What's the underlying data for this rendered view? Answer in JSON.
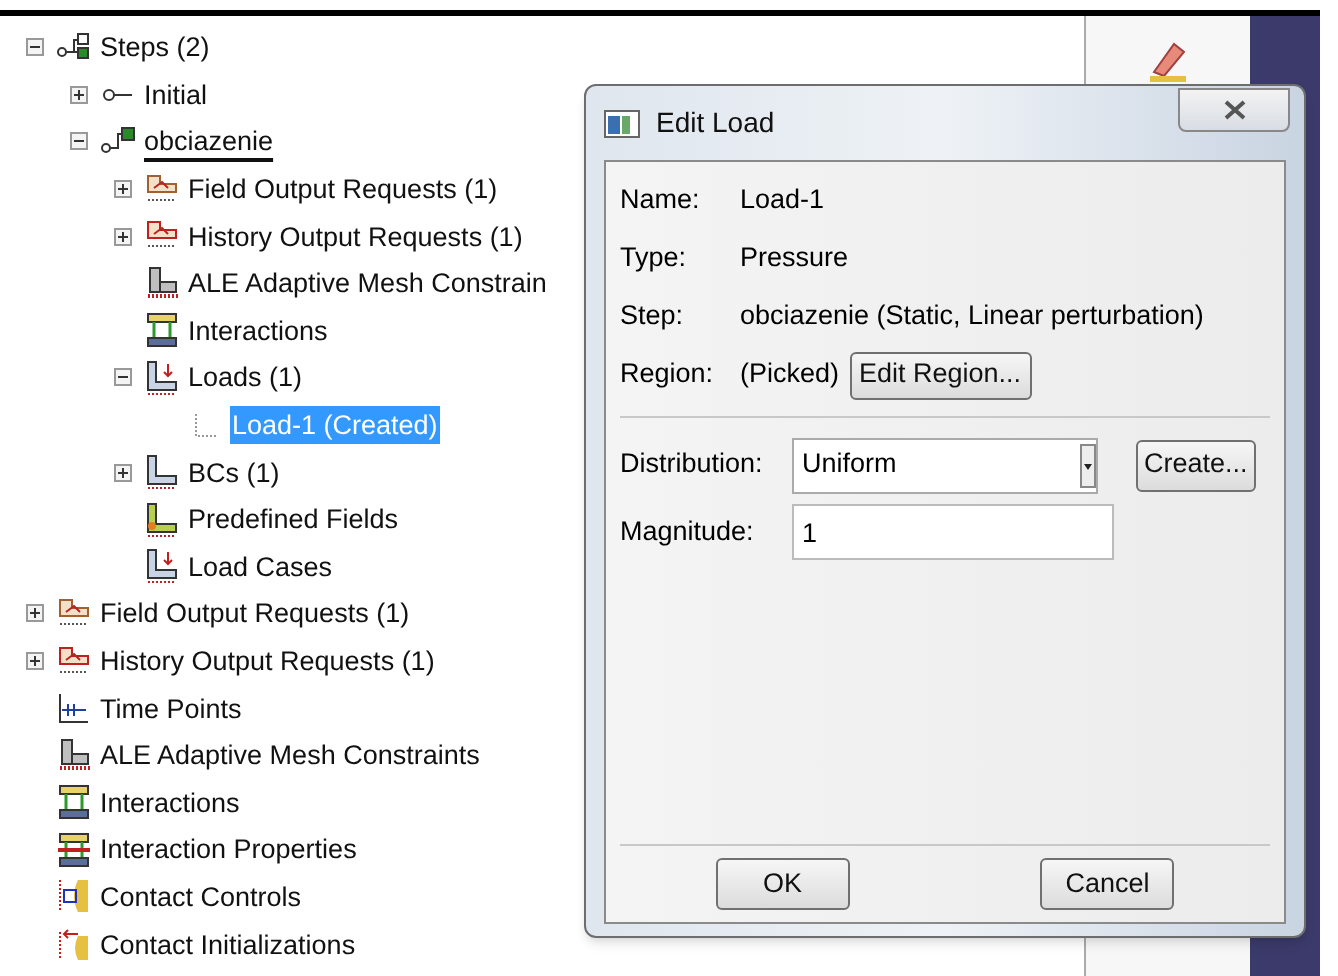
{
  "tree": [
    {
      "label": "Steps (2)",
      "kind": "steps",
      "selected": false,
      "current": false,
      "expanded": true,
      "children": [
        {
          "label": "Initial",
          "kind": "initial",
          "selected": false,
          "current": false,
          "expanded": false
        },
        {
          "label": "obciazenie",
          "kind": "step",
          "selected": false,
          "current": true,
          "expanded": true,
          "children": [
            {
              "label": "Field Output Requests (1)",
              "kind": "field-output",
              "selected": false,
              "current": false,
              "expanded": false
            },
            {
              "label": "History Output Requests (1)",
              "kind": "history-output",
              "selected": false,
              "current": false,
              "expanded": false
            },
            {
              "label": "ALE Adaptive Mesh Constrain",
              "kind": "ale",
              "selected": false,
              "current": false
            },
            {
              "label": "Interactions",
              "kind": "interactions",
              "selected": false,
              "current": false
            },
            {
              "label": "Loads (1)",
              "kind": "loads",
              "selected": false,
              "current": false,
              "expanded": true,
              "children": [
                {
                  "label": "Load-1 (Created)",
                  "kind": "load",
                  "selected": true,
                  "current": false
                }
              ]
            },
            {
              "label": "BCs (1)",
              "kind": "bcs",
              "selected": false,
              "current": false,
              "expanded": false
            },
            {
              "label": "Predefined Fields",
              "kind": "predefined",
              "selected": false,
              "current": false
            },
            {
              "label": "Load Cases",
              "kind": "loads",
              "selected": false,
              "current": false
            }
          ]
        }
      ]
    },
    {
      "label": "Field Output Requests (1)",
      "kind": "field-output",
      "selected": false,
      "current": false,
      "expanded": false
    },
    {
      "label": "History Output Requests (1)",
      "kind": "history-output",
      "selected": false,
      "current": false,
      "expanded": false
    },
    {
      "label": "Time Points",
      "kind": "time-points",
      "selected": false,
      "current": false
    },
    {
      "label": "ALE Adaptive Mesh Constraints",
      "kind": "ale",
      "selected": false,
      "current": false
    },
    {
      "label": "Interactions",
      "kind": "interactions",
      "selected": false,
      "current": false
    },
    {
      "label": "Interaction Properties",
      "kind": "interaction-properties",
      "selected": false,
      "current": false
    },
    {
      "label": "Contact Controls",
      "kind": "contact-controls",
      "selected": false,
      "current": false
    },
    {
      "label": "Contact Initializations",
      "kind": "contact-init",
      "selected": false,
      "current": false
    }
  ],
  "dialog": {
    "title": "Edit Load",
    "info": [
      {
        "label": "Name:",
        "value": "Load-1"
      },
      {
        "label": "Type:",
        "value": "Pressure"
      },
      {
        "label": "Step:",
        "value": "obciazenie (Static, Linear perturbation)"
      },
      {
        "label": "Region:",
        "value": "(Picked)",
        "button": "Edit Region..."
      }
    ],
    "distribution": {
      "label": "Distribution:",
      "value": "Uniform",
      "button": "Create..."
    },
    "magnitude": {
      "label": "Magnitude:",
      "value": "1"
    },
    "buttons": [
      "OK",
      "Cancel"
    ]
  }
}
